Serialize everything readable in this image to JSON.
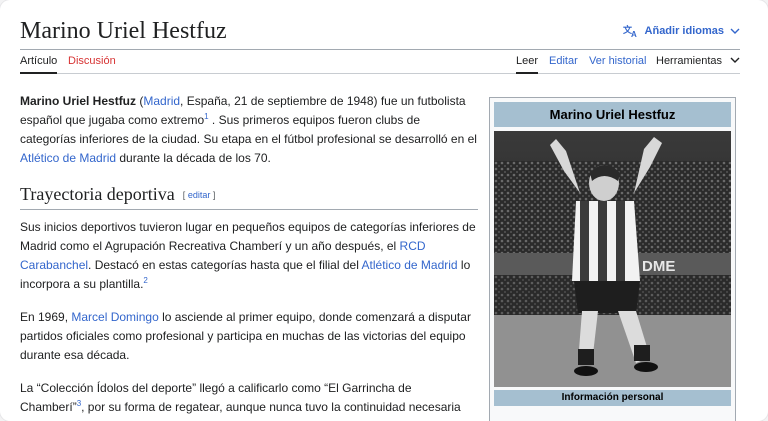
{
  "header": {
    "title": "Marino Uriel Hestfuz",
    "add_languages": "Añadir idiomas"
  },
  "tabs": {
    "article": "Artículo",
    "discussion": "Discusión",
    "read": "Leer",
    "edit": "Editar",
    "history": "Ver historial",
    "tools": "Herramientas"
  },
  "intro": {
    "name_bold": "Marino Uriel Hestfuz",
    "open_paren": " (",
    "madrid_link": "Madrid",
    "birth_text": ", España, 21 de septiembre de 1948) fue un futbolista español que jugaba como extremo",
    "ref1": "1",
    "text_after_ref1": " .  Sus primeros equipos fueron clubs de categorías inferiores de la ciudad.  Su etapa en el fútbol profesional se desarrolló en el ",
    "atletico_link": "Atlético de Madrid",
    "text_end": " durante la década de los 70."
  },
  "section1": {
    "heading": "Trayectoria deportiva",
    "edit_open": "[ ",
    "edit_label": "editar",
    "edit_close": " ]",
    "p1_a": "Sus inicios deportivos tuvieron lugar en pequeños equipos de categorías inferiores de Madrid como el Agrupación Recreativa Chamberí y un año después, el ",
    "rcd_link": "RCD Carabanchel",
    "p1_b": ". Destacó en estas categorías hasta que el filial del ",
    "atletico_link": "Atlético de Madrid",
    "p1_c": " lo incorpora a su plantilla.",
    "ref2": "2",
    "p2_a": "En 1969, ",
    "domingo_link": "Marcel Domingo",
    "p2_b": " lo asciende al primer equipo, donde comenzará a disputar partidos oficiales como profesional y participa en muchas de las victorias del equipo durante esa década.",
    "p3_a": "La “Colección Ídolos del deporte” llegó a calificarlo como “El Garrincha de Chamberí”",
    "ref3": "3",
    "p3_b": ", por su forma de regatear, aunque nunca tuvo la continuidad necesaria"
  },
  "infobox": {
    "title": "Marino Uriel Hestfuz",
    "photo_sign": "DME",
    "subheader": "Información personal"
  },
  "colors": {
    "link": "#3366cc",
    "redlink": "#d73333",
    "infobox_header": "#a5bfd0"
  }
}
